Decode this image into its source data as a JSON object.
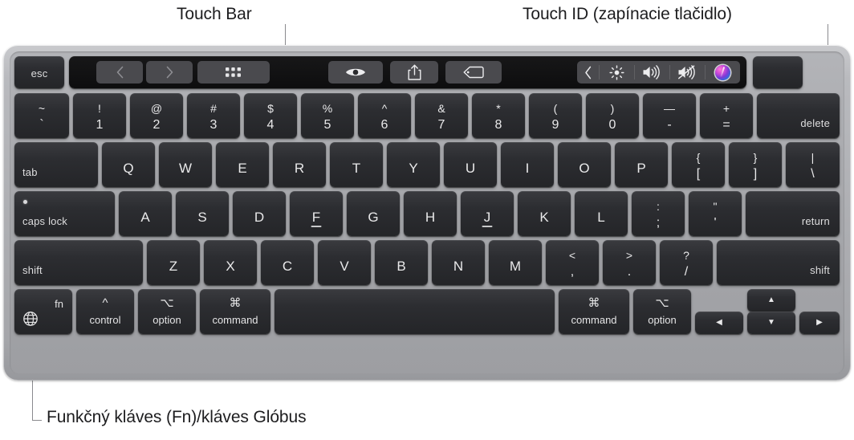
{
  "callouts": {
    "touch_bar": "Touch Bar",
    "touch_id": "Touch ID (zapínacie tlačidlo)",
    "fn_globe": "Funkčný kláves (Fn)/kláves Glóbus"
  },
  "colors": {
    "chassis": "#aeafb3",
    "key_face": "#2c2d31",
    "key_text": "#e9e9ea",
    "touchbar_bg": "#121213",
    "touchbar_button": "#4a4a4e",
    "siri_accent": "#d24bd8"
  },
  "touch_bar": {
    "esc_label": "esc",
    "app_buttons": [
      {
        "name": "back-icon",
        "glyph": "chevron-left"
      },
      {
        "name": "forward-icon",
        "glyph": "chevron-right"
      },
      {
        "name": "grid-view-icon",
        "glyph": "grid"
      },
      {
        "name": "quick-look-icon",
        "glyph": "eye"
      },
      {
        "name": "share-icon",
        "glyph": "share"
      },
      {
        "name": "tag-icon",
        "glyph": "tag"
      }
    ],
    "control_strip": [
      {
        "name": "expand-control-strip-icon",
        "glyph": "chevron-left"
      },
      {
        "name": "brightness-icon",
        "glyph": "brightness"
      },
      {
        "name": "volume-icon",
        "glyph": "volume"
      },
      {
        "name": "mute-icon",
        "glyph": "mute"
      },
      {
        "name": "siri-icon",
        "glyph": "siri"
      }
    ],
    "touch_id_label": ""
  },
  "rows": {
    "number_row": [
      {
        "name": "key-backtick",
        "top": "~",
        "bottom": "`"
      },
      {
        "name": "key-1",
        "top": "!",
        "bottom": "1"
      },
      {
        "name": "key-2",
        "top": "@",
        "bottom": "2"
      },
      {
        "name": "key-3",
        "top": "#",
        "bottom": "3"
      },
      {
        "name": "key-4",
        "top": "$",
        "bottom": "4"
      },
      {
        "name": "key-5",
        "top": "%",
        "bottom": "5"
      },
      {
        "name": "key-6",
        "top": "^",
        "bottom": "6"
      },
      {
        "name": "key-7",
        "top": "&",
        "bottom": "7"
      },
      {
        "name": "key-8",
        "top": "*",
        "bottom": "8"
      },
      {
        "name": "key-9",
        "top": "(",
        "bottom": "9"
      },
      {
        "name": "key-0",
        "top": ")",
        "bottom": "0"
      },
      {
        "name": "key-minus",
        "top": "—",
        "bottom": "-"
      },
      {
        "name": "key-equals",
        "top": "+",
        "bottom": "="
      },
      {
        "name": "key-delete",
        "corner": "delete"
      }
    ],
    "top_letter_row": [
      {
        "name": "key-tab",
        "corner": "tab"
      },
      {
        "name": "key-q",
        "mid": "Q"
      },
      {
        "name": "key-w",
        "mid": "W"
      },
      {
        "name": "key-e",
        "mid": "E"
      },
      {
        "name": "key-r",
        "mid": "R"
      },
      {
        "name": "key-t",
        "mid": "T"
      },
      {
        "name": "key-y",
        "mid": "Y"
      },
      {
        "name": "key-u",
        "mid": "U"
      },
      {
        "name": "key-i",
        "mid": "I"
      },
      {
        "name": "key-o",
        "mid": "O"
      },
      {
        "name": "key-p",
        "mid": "P"
      },
      {
        "name": "key-left-bracket",
        "top": "{",
        "bottom": "["
      },
      {
        "name": "key-right-bracket",
        "top": "}",
        "bottom": "]"
      },
      {
        "name": "key-backslash",
        "top": "|",
        "bottom": "\\"
      }
    ],
    "home_row": [
      {
        "name": "key-caps-lock",
        "corner": "caps lock"
      },
      {
        "name": "key-a",
        "mid": "A"
      },
      {
        "name": "key-s",
        "mid": "S"
      },
      {
        "name": "key-d",
        "mid": "D"
      },
      {
        "name": "key-f",
        "mid": "F"
      },
      {
        "name": "key-g",
        "mid": "G"
      },
      {
        "name": "key-h",
        "mid": "H"
      },
      {
        "name": "key-j",
        "mid": "J"
      },
      {
        "name": "key-k",
        "mid": "K"
      },
      {
        "name": "key-l",
        "mid": "L"
      },
      {
        "name": "key-semicolon",
        "top": ":",
        "bottom": ";"
      },
      {
        "name": "key-quote",
        "top": "\"",
        "bottom": "'"
      },
      {
        "name": "key-return",
        "corner": "return"
      }
    ],
    "bottom_letter_row": [
      {
        "name": "key-shift-left",
        "corner": "shift"
      },
      {
        "name": "key-z",
        "mid": "Z"
      },
      {
        "name": "key-x",
        "mid": "X"
      },
      {
        "name": "key-c",
        "mid": "C"
      },
      {
        "name": "key-v",
        "mid": "V"
      },
      {
        "name": "key-b",
        "mid": "B"
      },
      {
        "name": "key-n",
        "mid": "N"
      },
      {
        "name": "key-m",
        "mid": "M"
      },
      {
        "name": "key-comma",
        "top": "<",
        "bottom": ","
      },
      {
        "name": "key-period",
        "top": ">",
        "bottom": "."
      },
      {
        "name": "key-slash",
        "top": "?",
        "bottom": "/"
      },
      {
        "name": "key-shift-right",
        "corner": "shift"
      }
    ],
    "modifier_row": [
      {
        "name": "key-fn-globe",
        "label": "fn"
      },
      {
        "name": "key-control-left",
        "sym": "^",
        "word": "control"
      },
      {
        "name": "key-option-left",
        "sym": "⌥",
        "word": "option"
      },
      {
        "name": "key-command-left",
        "sym": "⌘",
        "word": "command"
      },
      {
        "name": "key-space",
        "word": ""
      },
      {
        "name": "key-command-right",
        "sym": "⌘",
        "word": "command"
      },
      {
        "name": "key-option-right",
        "sym": "⌥",
        "word": "option"
      },
      {
        "name": "key-arrow-left",
        "glyph": "◀"
      },
      {
        "name": "key-arrow-up",
        "glyph": "▲"
      },
      {
        "name": "key-arrow-down",
        "glyph": "▼"
      },
      {
        "name": "key-arrow-right",
        "glyph": "▶"
      }
    ]
  }
}
